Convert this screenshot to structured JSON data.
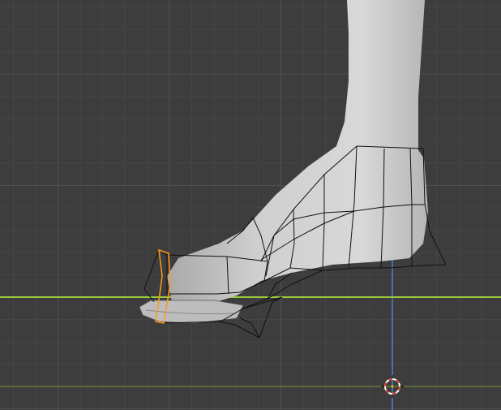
{
  "viewport": {
    "background": "#3d3d3d",
    "grid_minor_color": "#454545",
    "grid_major_color": "#4f4f4f",
    "x_axis_color": "#9ccc3c",
    "z_axis_color": "#4a7fd0",
    "mesh_fill_color": "#c6c6c6",
    "wire_color": "#111111",
    "selected_edge_color": "#ff9a1a",
    "cursor_color": "#d83b2f"
  },
  "objects": [
    {
      "name": "leg",
      "type": "mesh",
      "selected": false
    },
    {
      "name": "shoe",
      "type": "mesh",
      "selected": true,
      "mode": "edit"
    }
  ],
  "icons": [
    "3d-cursor-icon"
  ]
}
